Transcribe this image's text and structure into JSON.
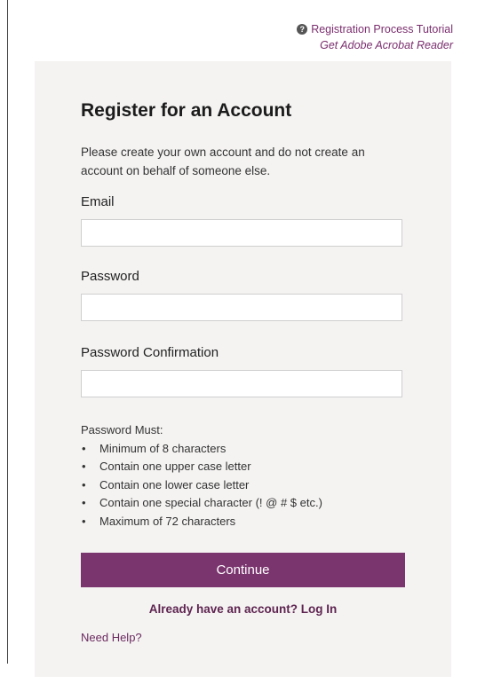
{
  "top_links": {
    "tutorial": "Registration Process Tutorial",
    "acrobat": "Get Adobe Acrobat Reader",
    "help_icon_glyph": "?"
  },
  "form": {
    "title": "Register for an Account",
    "intro": "Please create your own account and do not create an account on behalf of someone else.",
    "email_label": "Email",
    "email_value": "",
    "password_label": "Password",
    "password_value": "",
    "confirm_label": "Password Confirmation",
    "confirm_value": ""
  },
  "password_rules": {
    "heading": "Password Must:",
    "items": [
      "Minimum of 8 characters",
      "Contain one upper case letter",
      "Contain one lower case letter",
      "Contain one special character (! @ # $ etc.)",
      "Maximum of 72 characters"
    ]
  },
  "actions": {
    "continue_label": "Continue",
    "login_link": "Already have an account? Log In",
    "help_link": "Need Help?"
  },
  "colors": {
    "accent": "#7a346e",
    "link": "#7a2e6e",
    "panel_bg": "#f4f3f2"
  },
  "icons": {
    "help": "question-circle-icon"
  }
}
